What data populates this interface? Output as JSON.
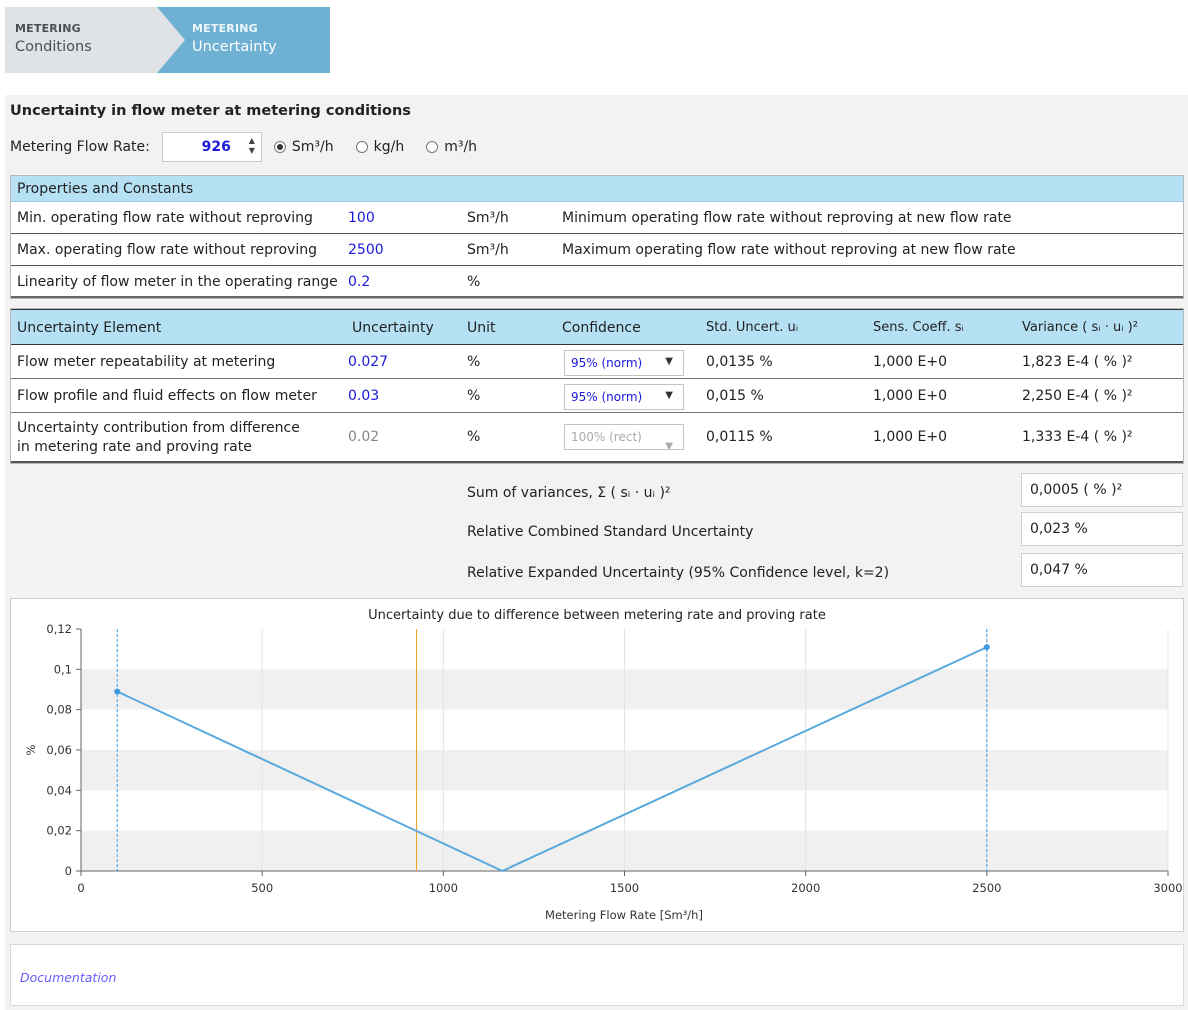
{
  "breadcrumb": [
    {
      "small": "METERING",
      "big": "Conditions"
    },
    {
      "small": "METERING",
      "big": "Uncertainty"
    }
  ],
  "section_title": "Uncertainty in flow meter at metering conditions",
  "flow": {
    "label": "Metering Flow Rate:",
    "value": "926",
    "units": [
      "Sm³/h",
      "kg/h",
      "m³/h"
    ],
    "selected_unit": "Sm³/h"
  },
  "properties": {
    "title": "Properties and Constants",
    "rows": [
      {
        "name": "Min. operating flow rate without reproving",
        "value": "100",
        "unit": "Sm³/h",
        "desc": "Minimum operating flow rate without reproving at new flow rate"
      },
      {
        "name": "Max. operating flow rate without reproving",
        "value": "2500",
        "unit": "Sm³/h",
        "desc": "Maximum operating flow rate without reproving at new flow rate"
      },
      {
        "name": "Linearity of flow meter in the operating range",
        "value": "0.2",
        "unit": "%",
        "desc": ""
      }
    ]
  },
  "uncert": {
    "headers": {
      "element": "Uncertainty Element",
      "uncertainty": "Uncertainty",
      "unit": "Unit",
      "confidence": "Confidence",
      "std": "Std. Uncert. uᵢ",
      "sens": "Sens. Coeff. sᵢ",
      "variance": "Variance ( sᵢ · uᵢ )²"
    },
    "rows": [
      {
        "element": "Flow meter repeatability at metering",
        "uncertainty": "0.027",
        "unit": "%",
        "confidence": "95% (norm)",
        "std": "0,0135  %",
        "sens": "1,000 E+0",
        "variance": "1,823 E-4  ( % )²"
      },
      {
        "element": "Flow profile and fluid effects on flow meter",
        "uncertainty": "0.03",
        "unit": "%",
        "confidence": "95% (norm)",
        "std": "0,015  %",
        "sens": "1,000 E+0",
        "variance": "2,250 E-4  ( % )²"
      },
      {
        "element_line1": "Uncertainty contribution from difference",
        "element_line2": "in metering rate and proving rate",
        "uncertainty": "0.02",
        "unit": "%",
        "confidence": "100% (rect)",
        "std": "0,0115  %",
        "sens": "1,000 E+0",
        "variance": "1,333 E-4  ( % )²"
      }
    ]
  },
  "summary": [
    {
      "label": "Sum of variances, Σ ( sᵢ · uᵢ )²",
      "value": "0,0005  ( % )²"
    },
    {
      "label": "Relative Combined Standard Uncertainty",
      "value": "0,023  %"
    },
    {
      "label": "Relative Expanded Uncertainty (95% Confidence level, k=2)",
      "value": "0,047  %"
    }
  ],
  "chart_data": {
    "type": "line",
    "title": "Uncertainty due to difference between metering rate and proving rate",
    "xlabel": "Metering Flow Rate [Sm³/h]",
    "ylabel": "%",
    "xlim": [
      0,
      3000
    ],
    "ylim": [
      0,
      0.12
    ],
    "xticks": [
      0,
      500,
      1000,
      1500,
      2000,
      2500,
      3000
    ],
    "xtick_labels": [
      "0",
      "500",
      "1000",
      "1500",
      "2000",
      "2500",
      "3000"
    ],
    "yticks": [
      0,
      0.02,
      0.04,
      0.06,
      0.08,
      0.1,
      0.12
    ],
    "ytick_labels": [
      "0",
      "0,02",
      "0,04",
      "0,06",
      "0,08",
      "0,1",
      "0,12"
    ],
    "series": [
      {
        "x": [
          100,
          1163,
          2500
        ],
        "y": [
          0.089,
          0,
          0.111
        ],
        "color": "#5aa9dd"
      }
    ],
    "points": [
      {
        "x": 100,
        "y": 0.089
      },
      {
        "x": 2500,
        "y": 0.111
      }
    ],
    "vlines": [
      {
        "x": 100,
        "color": "#3d9ae0",
        "style": "dashed"
      },
      {
        "x": 926,
        "color": "#f0a020",
        "style": "solid"
      },
      {
        "x": 2500,
        "color": "#3d9ae0",
        "style": "dashed"
      }
    ],
    "banded_background": true
  },
  "doc_link": "Documentation"
}
